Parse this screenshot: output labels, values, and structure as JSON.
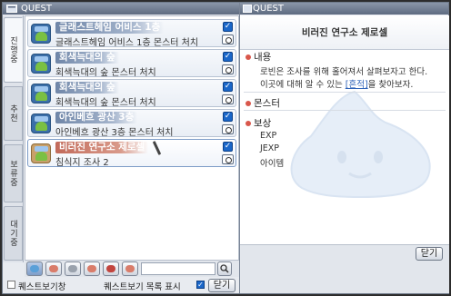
{
  "window": {
    "left_title": "QUEST",
    "right_title": "QUEST"
  },
  "tabs": [
    {
      "label": "진행중",
      "active": true
    },
    {
      "label": "추천",
      "active": false
    },
    {
      "label": "보류중",
      "active": false
    },
    {
      "label": "대기중",
      "active": false
    }
  ],
  "quests": [
    {
      "title": "글래스트헤임 어비스 1층",
      "desc": "글래스트헤임 어비스 1층 몬스터 처치",
      "checked": true,
      "selected": false
    },
    {
      "title": "회색늑대의 숲",
      "desc": "회색늑대의 숲 몬스터 처치",
      "checked": true,
      "selected": false
    },
    {
      "title": "회색늑대의 숲",
      "desc": "회색늑대의 숲 몬스터 처치",
      "checked": true,
      "selected": false
    },
    {
      "title": "아인베흐 광산 3층",
      "desc": "아인베흐 광산 3층 몬스터 처치",
      "checked": true,
      "selected": false
    },
    {
      "title": "비러진 연구소 제로셀",
      "desc": "침식지 조사 2",
      "checked": true,
      "selected": true
    }
  ],
  "footer": {
    "quest_view_window_label": "퀘스트보기창",
    "quest_view_window_checked": false,
    "quest_list_show_label": "퀘스트보기 목록 표시",
    "quest_list_show_checked": true,
    "close_label": "닫기"
  },
  "detail": {
    "title": "비러진 연구소 제로셀",
    "content_header": "내용",
    "content_line1": "로빈은 조사를 위해 홀어져서 살펴보자고 한다.",
    "content_line2_pre": "이곳에 대해 알 수 있는 ",
    "content_link": "[흔적]",
    "content_line2_post": "을 찾아보자.",
    "monster_header": "몬스터",
    "reward_header": "보상",
    "rewards": [
      "EXP",
      "JEXP",
      "아이템"
    ],
    "close_label": "닫기"
  },
  "colors": {
    "accent": "#1b67c9",
    "section_bullet": "#d9574b",
    "link": "#2d62b8"
  }
}
